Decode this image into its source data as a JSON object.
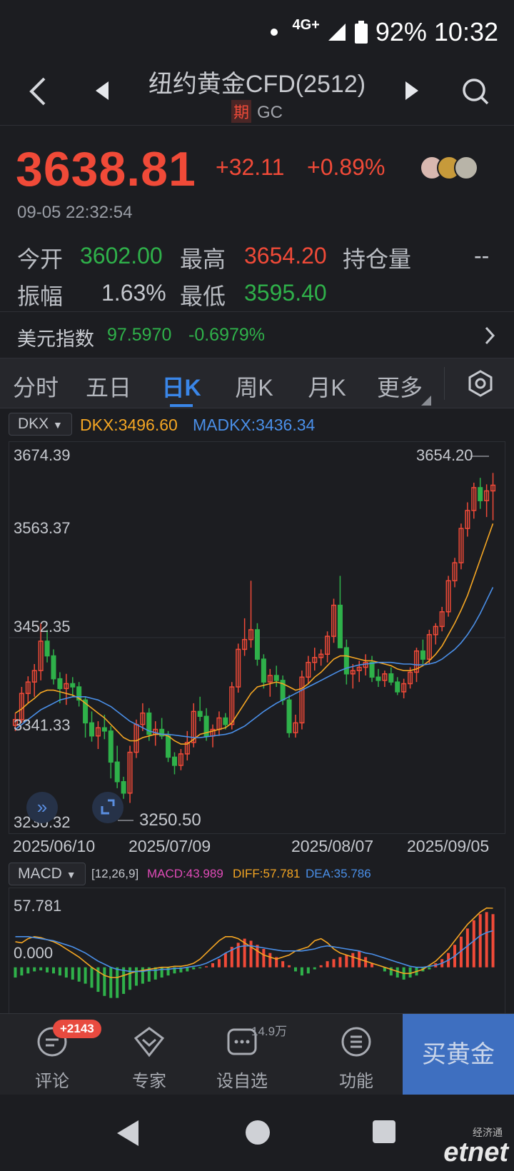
{
  "status_bar": {
    "network": "4G+",
    "battery": "92%",
    "time": "10:32"
  },
  "header": {
    "title": "纽约黄金CFD(2512)",
    "tag": "期",
    "symbol": "GC"
  },
  "quote": {
    "price": "3638.81",
    "change": "+32.11",
    "change_pct": "+0.89%",
    "datetime": "09-05 22:32:54",
    "stats": [
      {
        "label": "今开",
        "value": "3602.00"
      },
      {
        "label": "最高",
        "value": "3654.20"
      },
      {
        "label": "持仓量",
        "value": "--"
      },
      {
        "label": "振幅",
        "value": "1.63%"
      },
      {
        "label": "最低",
        "value": "3595.40"
      }
    ]
  },
  "dollar_index": {
    "label": "美元指数",
    "value": "97.5970",
    "change_pct": "-0.6979%"
  },
  "tabs": [
    {
      "label": "分时"
    },
    {
      "label": "五日"
    },
    {
      "label": "日K"
    },
    {
      "label": "周K"
    },
    {
      "label": "月K"
    },
    {
      "label": "更多"
    }
  ],
  "indicator": {
    "selector": "DKX",
    "dkx": "DKX:3496.60",
    "madkx": "MADKX:3436.34"
  },
  "macd_indicator": {
    "selector": "MACD",
    "params": "[12,26,9]",
    "macd": "MACD:43.989",
    "diff": "DIFF:57.781",
    "dea": "DEA:35.786"
  },
  "colors": {
    "up": "#f04a38",
    "down": "#2fb14a",
    "dkx": "#f5a623",
    "madkx": "#4a8fe8",
    "macd": "#e04bb8",
    "accent": "#3a86e8"
  },
  "chart_data": [
    {
      "type": "candlestick",
      "title": "",
      "y_ticks": [
        "3674.39",
        "3563.37",
        "3452.35",
        "3341.33",
        "3230.32"
      ],
      "ylim": [
        3230.32,
        3674.39
      ],
      "x_ticks": [
        "2025/06/10",
        "2025/07/09",
        "2025/08/07",
        "2025/09/05"
      ],
      "high_marker": "3654.20",
      "low_marker": "3250.50",
      "candles": [
        [
          3345,
          3360,
          3338,
          3352
        ],
        [
          3352,
          3392,
          3348,
          3384
        ],
        [
          3384,
          3405,
          3372,
          3398
        ],
        [
          3398,
          3420,
          3380,
          3412
        ],
        [
          3412,
          3470,
          3400,
          3448
        ],
        [
          3448,
          3462,
          3422,
          3430
        ],
        [
          3430,
          3438,
          3395,
          3402
        ],
        [
          3402,
          3410,
          3372,
          3390
        ],
        [
          3390,
          3408,
          3370,
          3396
        ],
        [
          3396,
          3404,
          3380,
          3392
        ],
        [
          3392,
          3398,
          3368,
          3376
        ],
        [
          3376,
          3380,
          3330,
          3348
        ],
        [
          3348,
          3362,
          3325,
          3332
        ],
        [
          3332,
          3350,
          3316,
          3342
        ],
        [
          3342,
          3358,
          3328,
          3338
        ],
        [
          3338,
          3344,
          3280,
          3300
        ],
        [
          3300,
          3320,
          3268,
          3276
        ],
        [
          3276,
          3282,
          3255,
          3262
        ],
        [
          3262,
          3320,
          3250,
          3312
        ],
        [
          3312,
          3352,
          3305,
          3346
        ],
        [
          3346,
          3372,
          3338,
          3360
        ],
        [
          3360,
          3366,
          3326,
          3334
        ],
        [
          3334,
          3350,
          3320,
          3340
        ],
        [
          3340,
          3354,
          3328,
          3332
        ],
        [
          3332,
          3338,
          3300,
          3306
        ],
        [
          3306,
          3312,
          3285,
          3296
        ],
        [
          3296,
          3316,
          3290,
          3310
        ],
        [
          3310,
          3338,
          3302,
          3324
        ],
        [
          3324,
          3372,
          3318,
          3362
        ],
        [
          3362,
          3380,
          3350,
          3356
        ],
        [
          3356,
          3366,
          3326,
          3332
        ],
        [
          3332,
          3346,
          3318,
          3340
        ],
        [
          3340,
          3362,
          3332,
          3354
        ],
        [
          3354,
          3360,
          3340,
          3346
        ],
        [
          3346,
          3398,
          3340,
          3392
        ],
        [
          3392,
          3445,
          3385,
          3438
        ],
        [
          3438,
          3476,
          3430,
          3450
        ],
        [
          3450,
          3522,
          3440,
          3462
        ],
        [
          3462,
          3470,
          3418,
          3426
        ],
        [
          3426,
          3432,
          3390,
          3398
        ],
        [
          3398,
          3414,
          3380,
          3406
        ],
        [
          3406,
          3418,
          3392,
          3400
        ],
        [
          3400,
          3406,
          3370,
          3376
        ],
        [
          3376,
          3382,
          3330,
          3336
        ],
        [
          3336,
          3358,
          3330,
          3348
        ],
        [
          3348,
          3412,
          3340,
          3404
        ],
        [
          3404,
          3430,
          3396,
          3422
        ],
        [
          3422,
          3440,
          3412,
          3428
        ],
        [
          3428,
          3438,
          3418,
          3432
        ],
        [
          3432,
          3460,
          3422,
          3454
        ],
        [
          3454,
          3500,
          3446,
          3492
        ],
        [
          3492,
          3528,
          3470,
          3440
        ],
        [
          3440,
          3450,
          3395,
          3408
        ],
        [
          3408,
          3420,
          3390,
          3412
        ],
        [
          3412,
          3424,
          3398,
          3416
        ],
        [
          3416,
          3432,
          3406,
          3422
        ],
        [
          3422,
          3430,
          3398,
          3404
        ],
        [
          3404,
          3414,
          3392,
          3400
        ],
        [
          3400,
          3412,
          3392,
          3408
        ],
        [
          3408,
          3416,
          3394,
          3398
        ],
        [
          3398,
          3404,
          3382,
          3386
        ],
        [
          3386,
          3402,
          3378,
          3396
        ],
        [
          3396,
          3416,
          3390,
          3410
        ],
        [
          3410,
          3440,
          3398,
          3436
        ],
        [
          3436,
          3450,
          3420,
          3426
        ],
        [
          3426,
          3462,
          3420,
          3456
        ],
        [
          3456,
          3470,
          3444,
          3466
        ],
        [
          3466,
          3490,
          3460,
          3484
        ],
        [
          3484,
          3528,
          3478,
          3522
        ],
        [
          3522,
          3550,
          3514,
          3544
        ],
        [
          3544,
          3592,
          3536,
          3586
        ],
        [
          3586,
          3618,
          3576,
          3608
        ],
        [
          3608,
          3642,
          3598,
          3636
        ],
        [
          3636,
          3648,
          3610,
          3620
        ],
        [
          3620,
          3640,
          3600,
          3632
        ],
        [
          3632,
          3654,
          3596,
          3639
        ]
      ],
      "dkx": [
        3360,
        3365,
        3372,
        3378,
        3385,
        3388,
        3388,
        3386,
        3384,
        3382,
        3378,
        3372,
        3366,
        3360,
        3354,
        3346,
        3338,
        3330,
        3326,
        3326,
        3330,
        3332,
        3334,
        3334,
        3332,
        3326,
        3322,
        3322,
        3328,
        3334,
        3336,
        3338,
        3340,
        3342,
        3348,
        3360,
        3372,
        3384,
        3392,
        3394,
        3396,
        3398,
        3396,
        3392,
        3388,
        3390,
        3396,
        3404,
        3410,
        3418,
        3426,
        3430,
        3430,
        3428,
        3426,
        3424,
        3424,
        3422,
        3420,
        3418,
        3414,
        3412,
        3412,
        3414,
        3418,
        3424,
        3432,
        3442,
        3456,
        3470,
        3486,
        3504,
        3526,
        3548,
        3570,
        3592
      ],
      "madkx": [
        3340,
        3346,
        3352,
        3358,
        3364,
        3368,
        3372,
        3376,
        3378,
        3380,
        3380,
        3380,
        3378,
        3376,
        3372,
        3368,
        3362,
        3356,
        3350,
        3346,
        3342,
        3338,
        3336,
        3334,
        3334,
        3333,
        3332,
        3331,
        3330,
        3330,
        3331,
        3332,
        3333,
        3334,
        3336,
        3340,
        3344,
        3350,
        3356,
        3362,
        3367,
        3372,
        3376,
        3380,
        3384,
        3388,
        3392,
        3396,
        3400,
        3404,
        3408,
        3412,
        3415,
        3417,
        3419,
        3420,
        3421,
        3422,
        3422,
        3422,
        3421,
        3420,
        3420,
        3419,
        3419,
        3420,
        3422,
        3426,
        3432,
        3438,
        3446,
        3456,
        3468,
        3482,
        3498,
        3514
      ]
    },
    {
      "type": "bar",
      "title": "MACD",
      "y_ticks": [
        "57.781",
        "0.000"
      ],
      "ylim": [
        -40,
        57.781
      ],
      "histogram": [
        -10,
        -8,
        -6,
        -4,
        -3,
        -5,
        -6,
        -8,
        -10,
        -12,
        -14,
        -16,
        -20,
        -24,
        -28,
        -30,
        -30,
        -26,
        -22,
        -18,
        -16,
        -14,
        -12,
        -10,
        -8,
        -6,
        -5,
        -4,
        -2,
        -1,
        1,
        4,
        8,
        14,
        20,
        24,
        28,
        26,
        22,
        18,
        14,
        10,
        6,
        2,
        -4,
        -8,
        -6,
        -2,
        2,
        6,
        8,
        10,
        12,
        14,
        16,
        10,
        4,
        0,
        -4,
        -8,
        -10,
        -12,
        -10,
        -8,
        -4,
        -2,
        4,
        8,
        14,
        22,
        30,
        38,
        46,
        52,
        54,
        52
      ],
      "diff": [
        25,
        24,
        28,
        30,
        29,
        27,
        25,
        22,
        18,
        14,
        10,
        5,
        0,
        -4,
        -8,
        -10,
        -10,
        -8,
        -6,
        -4,
        -3,
        -2,
        -1,
        0,
        0,
        1,
        1,
        2,
        4,
        8,
        14,
        20,
        26,
        30,
        30,
        28,
        24,
        20,
        16,
        12,
        10,
        8,
        10,
        12,
        16,
        18,
        20,
        26,
        28,
        24,
        18,
        14,
        12,
        10,
        8,
        6,
        4,
        2,
        0,
        -2,
        -4,
        -6,
        -6,
        -4,
        -2,
        2,
        6,
        12,
        18,
        26,
        34,
        42,
        48,
        54,
        58,
        57.781
      ],
      "dea": [
        30,
        30,
        30,
        29,
        28,
        27,
        26,
        24,
        22,
        20,
        17,
        14,
        10,
        6,
        3,
        0,
        -2,
        -3,
        -4,
        -4,
        -4,
        -3,
        -3,
        -2,
        -2,
        -1,
        -1,
        0,
        1,
        2,
        4,
        7,
        10,
        14,
        17,
        20,
        21,
        21,
        20,
        19,
        18,
        17,
        16,
        16,
        16,
        16,
        17,
        18,
        20,
        21,
        20,
        19,
        18,
        17,
        16,
        14,
        13,
        11,
        9,
        7,
        5,
        3,
        1,
        0,
        0,
        1,
        2,
        4,
        7,
        11,
        16,
        21,
        26,
        31,
        34,
        35.786
      ]
    }
  ],
  "bottom_bar": {
    "items": [
      {
        "label": "评论",
        "badge": "+2143"
      },
      {
        "label": "专家"
      },
      {
        "label": "设自选",
        "count": "14.9万"
      },
      {
        "label": "功能"
      }
    ],
    "buy_label": "买黄金"
  },
  "watermark": {
    "top": "经济通",
    "bottom": "etnet"
  }
}
